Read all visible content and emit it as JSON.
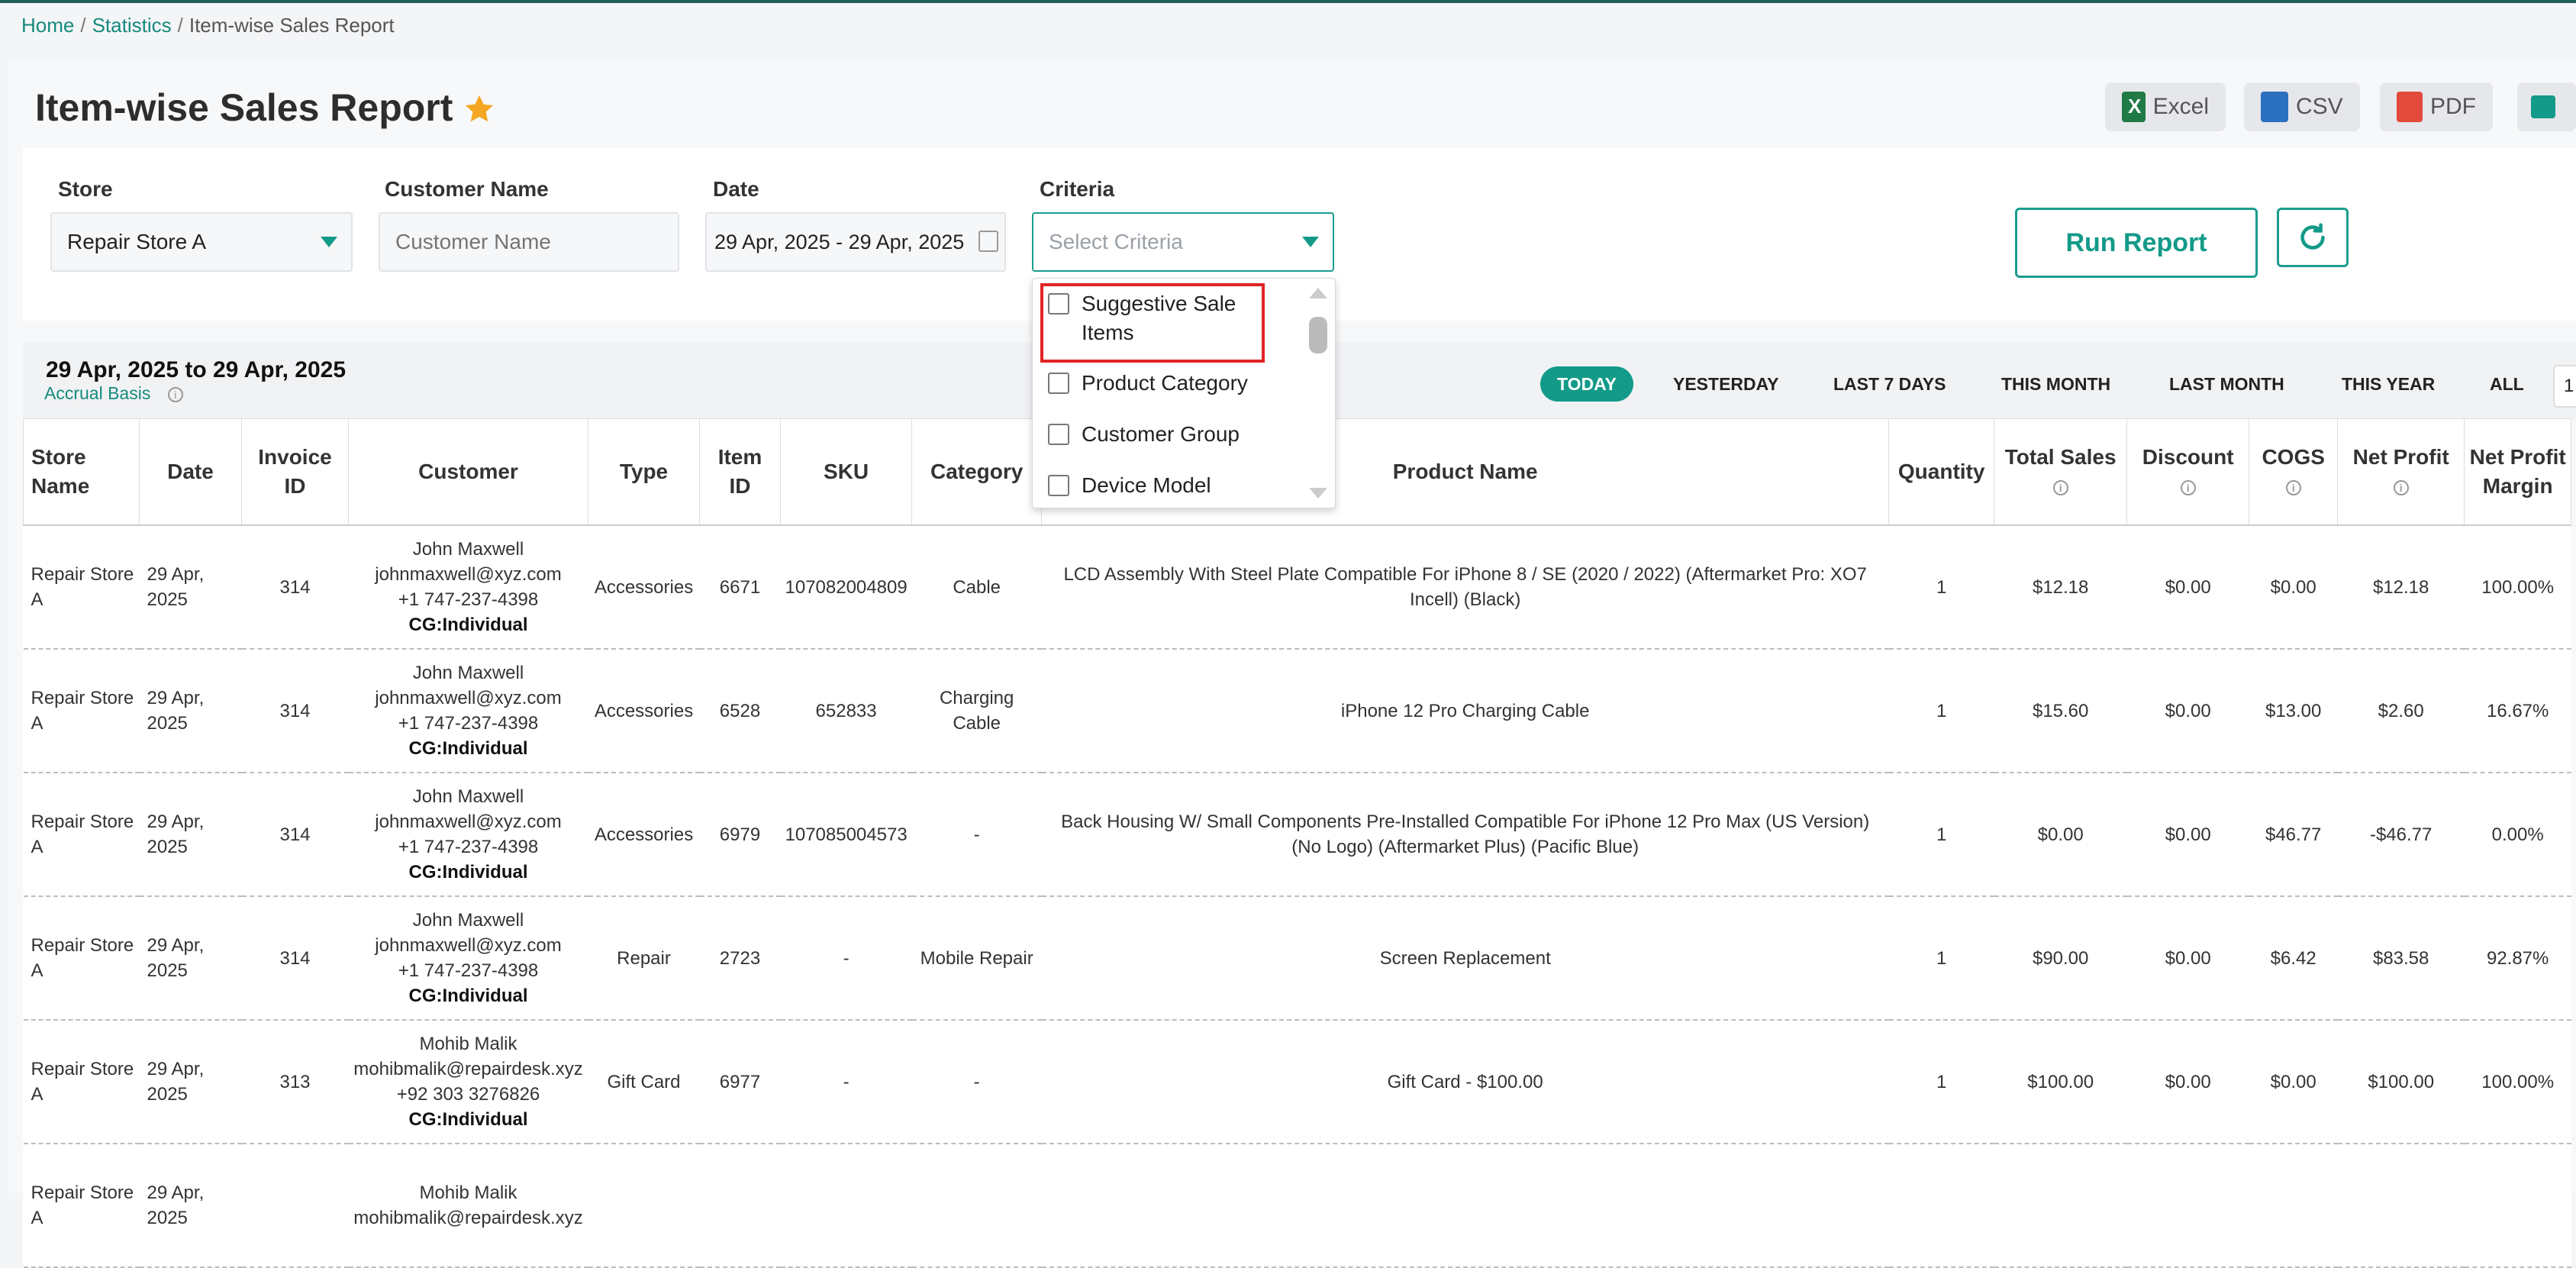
{
  "breadcrumb": {
    "home": "Home",
    "stats": "Statistics",
    "current": "Item-wise Sales Report",
    "sep": "/"
  },
  "page_title": "Item-wise Sales Report",
  "exports": {
    "excel": "Excel",
    "csv": "CSV",
    "pdf": "PDF"
  },
  "filters": {
    "store_label": "Store",
    "store_value": "Repair Store A",
    "customer_label": "Customer Name",
    "customer_placeholder": "Customer Name",
    "date_label": "Date",
    "date_value": "29 Apr, 2025 - 29 Apr, 2025",
    "criteria_label": "Criteria",
    "criteria_placeholder": "Select Criteria"
  },
  "run_label": "Run Report",
  "criteria_options": [
    "Suggestive Sale Items",
    "Product Category",
    "Customer Group",
    "Device Model"
  ],
  "range": {
    "title": "29 Apr, 2025 to 29 Apr, 2025",
    "accrual": "Accrual Basis",
    "info": "i"
  },
  "periods": [
    "TODAY",
    "YESTERDAY",
    "LAST 7 DAYS",
    "THIS MONTH",
    "LAST MONTH",
    "THIS YEAR",
    "ALL"
  ],
  "page_num": "1",
  "columns": [
    "Store Name",
    "Date",
    "Invoice ID",
    "Customer",
    "Type",
    "Item ID",
    "SKU",
    "Category",
    "Product Name",
    "Quantity",
    "Total Sales",
    "Discount",
    "COGS",
    "Net Profit",
    "Net Profit Margin"
  ],
  "rows": [
    {
      "store": "Repair Store A",
      "date": "29 Apr, 2025",
      "invoice": "314",
      "cust_name": "John Maxwell",
      "cust_email": "johnmaxwell@xyz.com",
      "cust_phone": "+1 747-237-4398",
      "cust_group": "CG:Individual",
      "type": "Accessories",
      "item_id": "6671",
      "sku": "107082004809",
      "category": "Cable",
      "product": "LCD Assembly With Steel Plate Compatible For iPhone 8 / SE (2020 / 2022) (Aftermarket Pro: XO7 Incell) (Black)",
      "qty": "1",
      "sales": "$12.18",
      "discount": "$0.00",
      "cogs": "$0.00",
      "profit": "$12.18",
      "margin": "100.00%"
    },
    {
      "store": "Repair Store A",
      "date": "29 Apr, 2025",
      "invoice": "314",
      "cust_name": "John Maxwell",
      "cust_email": "johnmaxwell@xyz.com",
      "cust_phone": "+1 747-237-4398",
      "cust_group": "CG:Individual",
      "type": "Accessories",
      "item_id": "6528",
      "sku": "652833",
      "category": "Charging Cable",
      "product": "iPhone 12 Pro Charging Cable",
      "qty": "1",
      "sales": "$15.60",
      "discount": "$0.00",
      "cogs": "$13.00",
      "profit": "$2.60",
      "margin": "16.67%"
    },
    {
      "store": "Repair Store A",
      "date": "29 Apr, 2025",
      "invoice": "314",
      "cust_name": "John Maxwell",
      "cust_email": "johnmaxwell@xyz.com",
      "cust_phone": "+1 747-237-4398",
      "cust_group": "CG:Individual",
      "type": "Accessories",
      "item_id": "6979",
      "sku": "107085004573",
      "category": "-",
      "product": "Back Housing W/ Small Components Pre-Installed Compatible For iPhone 12 Pro Max (US Version) (No Logo) (Aftermarket Plus) (Pacific Blue)",
      "qty": "1",
      "sales": "$0.00",
      "discount": "$0.00",
      "cogs": "$46.77",
      "profit": "-$46.77",
      "margin": "0.00%"
    },
    {
      "store": "Repair Store A",
      "date": "29 Apr, 2025",
      "invoice": "314",
      "cust_name": "John Maxwell",
      "cust_email": "johnmaxwell@xyz.com",
      "cust_phone": "+1 747-237-4398",
      "cust_group": "CG:Individual",
      "type": "Repair",
      "item_id": "2723",
      "sku": "-",
      "category": "Mobile Repair",
      "product": "Screen Replacement",
      "qty": "1",
      "sales": "$90.00",
      "discount": "$0.00",
      "cogs": "$6.42",
      "profit": "$83.58",
      "margin": "92.87%"
    },
    {
      "store": "Repair Store A",
      "date": "29 Apr, 2025",
      "invoice": "313",
      "cust_name": "Mohib Malik",
      "cust_email": "mohibmalik@repairdesk.xyz",
      "cust_phone": "+92 303 3276826",
      "cust_group": "CG:Individual",
      "type": "Gift Card",
      "item_id": "6977",
      "sku": "-",
      "category": "-",
      "product": "Gift Card - $100.00",
      "qty": "1",
      "sales": "$100.00",
      "discount": "$0.00",
      "cogs": "$0.00",
      "profit": "$100.00",
      "margin": "100.00%"
    },
    {
      "store": "Repair Store A",
      "date": "29 Apr, 2025",
      "invoice": "",
      "cust_name": "Mohib Malik",
      "cust_email": "mohibmalik@repairdesk.xyz",
      "cust_phone": "",
      "cust_group": "",
      "type": "",
      "item_id": "",
      "sku": "",
      "category": "",
      "product": "",
      "qty": "",
      "sales": "",
      "discount": "",
      "cogs": "",
      "profit": "",
      "margin": ""
    }
  ]
}
